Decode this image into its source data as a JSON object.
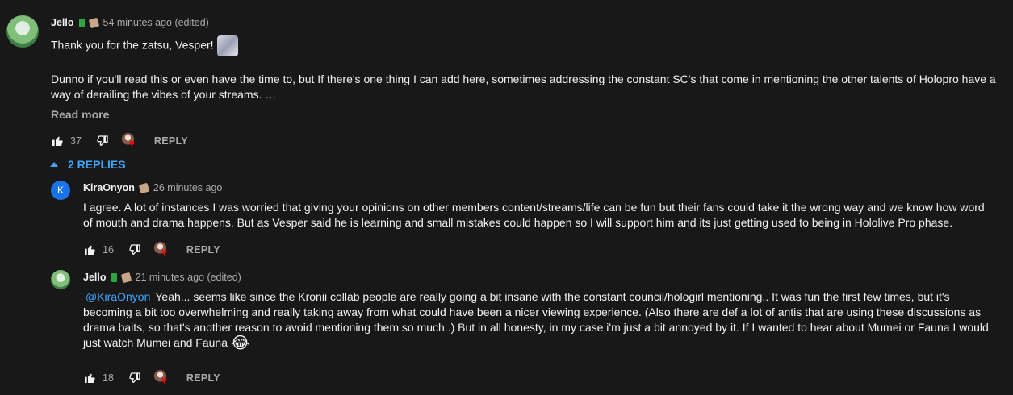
{
  "comment": {
    "author": "Jello",
    "time": "54 minutes ago (edited)",
    "line1": "Thank you for the zatsu, Vesper!",
    "line2a": "Dunno if you'll read this or even have the time to, but If there's one thing I can add here, sometimes addressing the constant SC's that come in mentioning the other talents of Holopro have a",
    "line2b": "way of derailing the vibes of your streams. …",
    "read_more": "Read more",
    "likes": "37",
    "reply_label": "REPLY",
    "avatar_icon": "anime-avatar-icon"
  },
  "replies_toggle": "2 REPLIES",
  "reply1": {
    "author": "KiraOnyon",
    "avatar_letter": "K",
    "time": "26 minutes ago",
    "line1": "I agree. A lot of instances I was worried that giving your opinions on other members content/streams/life can be fun but their fans could take it the wrong way and we know how word",
    "line2": "of mouth and drama happens. But as Vesper said he is learning and small mistakes could happen so I will support him and its just getting used to being in Hololive Pro phase.",
    "likes": "16",
    "reply_label": "REPLY"
  },
  "reply2": {
    "author": "Jello",
    "time": "21 minutes ago (edited)",
    "mention": "@KiraOnyon",
    "line1": "Yeah... seems like since the Kronii collab people are really going a bit insane with the constant council/hologirl mentioning.. It was fun the first few times, but it's",
    "line2": "becoming a bit too overwhelming and really taking away from what could have been a nicer viewing experience. (Also there are def a lot of antis that are using these discussions as",
    "line3": "drama baits, so that's another reason to avoid mentioning them so much..) But in all honesty, in my case i'm just a bit annoyed by it. If I wanted to hear about Mumei or Fauna I would",
    "line4": "just watch Mumei and Fauna",
    "emoji": "😂",
    "likes": "18",
    "reply_label": "REPLY"
  },
  "colors": {
    "background": "#181818",
    "text": "#f1f1f1",
    "secondary": "#aaaaaa",
    "link": "#3ea6ff",
    "heart": "#ff0000"
  }
}
